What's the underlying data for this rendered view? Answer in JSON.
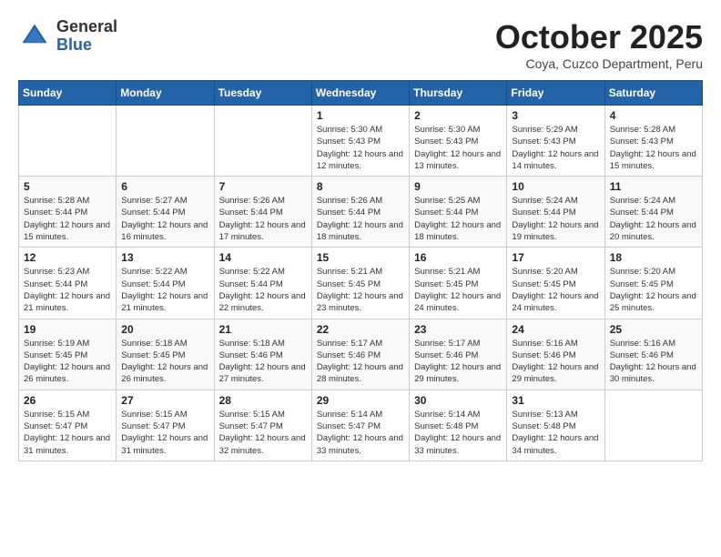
{
  "logo": {
    "general": "General",
    "blue": "Blue"
  },
  "header": {
    "title": "October 2025",
    "subtitle": "Coya, Cuzco Department, Peru"
  },
  "days_of_week": [
    "Sunday",
    "Monday",
    "Tuesday",
    "Wednesday",
    "Thursday",
    "Friday",
    "Saturday"
  ],
  "weeks": [
    [
      {
        "day": "",
        "info": ""
      },
      {
        "day": "",
        "info": ""
      },
      {
        "day": "",
        "info": ""
      },
      {
        "day": "1",
        "info": "Sunrise: 5:30 AM\nSunset: 5:43 PM\nDaylight: 12 hours\nand 12 minutes."
      },
      {
        "day": "2",
        "info": "Sunrise: 5:30 AM\nSunset: 5:43 PM\nDaylight: 12 hours\nand 13 minutes."
      },
      {
        "day": "3",
        "info": "Sunrise: 5:29 AM\nSunset: 5:43 PM\nDaylight: 12 hours\nand 14 minutes."
      },
      {
        "day": "4",
        "info": "Sunrise: 5:28 AM\nSunset: 5:43 PM\nDaylight: 12 hours\nand 15 minutes."
      }
    ],
    [
      {
        "day": "5",
        "info": "Sunrise: 5:28 AM\nSunset: 5:44 PM\nDaylight: 12 hours\nand 15 minutes."
      },
      {
        "day": "6",
        "info": "Sunrise: 5:27 AM\nSunset: 5:44 PM\nDaylight: 12 hours\nand 16 minutes."
      },
      {
        "day": "7",
        "info": "Sunrise: 5:26 AM\nSunset: 5:44 PM\nDaylight: 12 hours\nand 17 minutes."
      },
      {
        "day": "8",
        "info": "Sunrise: 5:26 AM\nSunset: 5:44 PM\nDaylight: 12 hours\nand 18 minutes."
      },
      {
        "day": "9",
        "info": "Sunrise: 5:25 AM\nSunset: 5:44 PM\nDaylight: 12 hours\nand 18 minutes."
      },
      {
        "day": "10",
        "info": "Sunrise: 5:24 AM\nSunset: 5:44 PM\nDaylight: 12 hours\nand 19 minutes."
      },
      {
        "day": "11",
        "info": "Sunrise: 5:24 AM\nSunset: 5:44 PM\nDaylight: 12 hours\nand 20 minutes."
      }
    ],
    [
      {
        "day": "12",
        "info": "Sunrise: 5:23 AM\nSunset: 5:44 PM\nDaylight: 12 hours\nand 21 minutes."
      },
      {
        "day": "13",
        "info": "Sunrise: 5:22 AM\nSunset: 5:44 PM\nDaylight: 12 hours\nand 21 minutes."
      },
      {
        "day": "14",
        "info": "Sunrise: 5:22 AM\nSunset: 5:44 PM\nDaylight: 12 hours\nand 22 minutes."
      },
      {
        "day": "15",
        "info": "Sunrise: 5:21 AM\nSunset: 5:45 PM\nDaylight: 12 hours\nand 23 minutes."
      },
      {
        "day": "16",
        "info": "Sunrise: 5:21 AM\nSunset: 5:45 PM\nDaylight: 12 hours\nand 24 minutes."
      },
      {
        "day": "17",
        "info": "Sunrise: 5:20 AM\nSunset: 5:45 PM\nDaylight: 12 hours\nand 24 minutes."
      },
      {
        "day": "18",
        "info": "Sunrise: 5:20 AM\nSunset: 5:45 PM\nDaylight: 12 hours\nand 25 minutes."
      }
    ],
    [
      {
        "day": "19",
        "info": "Sunrise: 5:19 AM\nSunset: 5:45 PM\nDaylight: 12 hours\nand 26 minutes."
      },
      {
        "day": "20",
        "info": "Sunrise: 5:18 AM\nSunset: 5:45 PM\nDaylight: 12 hours\nand 26 minutes."
      },
      {
        "day": "21",
        "info": "Sunrise: 5:18 AM\nSunset: 5:46 PM\nDaylight: 12 hours\nand 27 minutes."
      },
      {
        "day": "22",
        "info": "Sunrise: 5:17 AM\nSunset: 5:46 PM\nDaylight: 12 hours\nand 28 minutes."
      },
      {
        "day": "23",
        "info": "Sunrise: 5:17 AM\nSunset: 5:46 PM\nDaylight: 12 hours\nand 29 minutes."
      },
      {
        "day": "24",
        "info": "Sunrise: 5:16 AM\nSunset: 5:46 PM\nDaylight: 12 hours\nand 29 minutes."
      },
      {
        "day": "25",
        "info": "Sunrise: 5:16 AM\nSunset: 5:46 PM\nDaylight: 12 hours\nand 30 minutes."
      }
    ],
    [
      {
        "day": "26",
        "info": "Sunrise: 5:15 AM\nSunset: 5:47 PM\nDaylight: 12 hours\nand 31 minutes."
      },
      {
        "day": "27",
        "info": "Sunrise: 5:15 AM\nSunset: 5:47 PM\nDaylight: 12 hours\nand 31 minutes."
      },
      {
        "day": "28",
        "info": "Sunrise: 5:15 AM\nSunset: 5:47 PM\nDaylight: 12 hours\nand 32 minutes."
      },
      {
        "day": "29",
        "info": "Sunrise: 5:14 AM\nSunset: 5:47 PM\nDaylight: 12 hours\nand 33 minutes."
      },
      {
        "day": "30",
        "info": "Sunrise: 5:14 AM\nSunset: 5:48 PM\nDaylight: 12 hours\nand 33 minutes."
      },
      {
        "day": "31",
        "info": "Sunrise: 5:13 AM\nSunset: 5:48 PM\nDaylight: 12 hours\nand 34 minutes."
      },
      {
        "day": "",
        "info": ""
      }
    ]
  ]
}
